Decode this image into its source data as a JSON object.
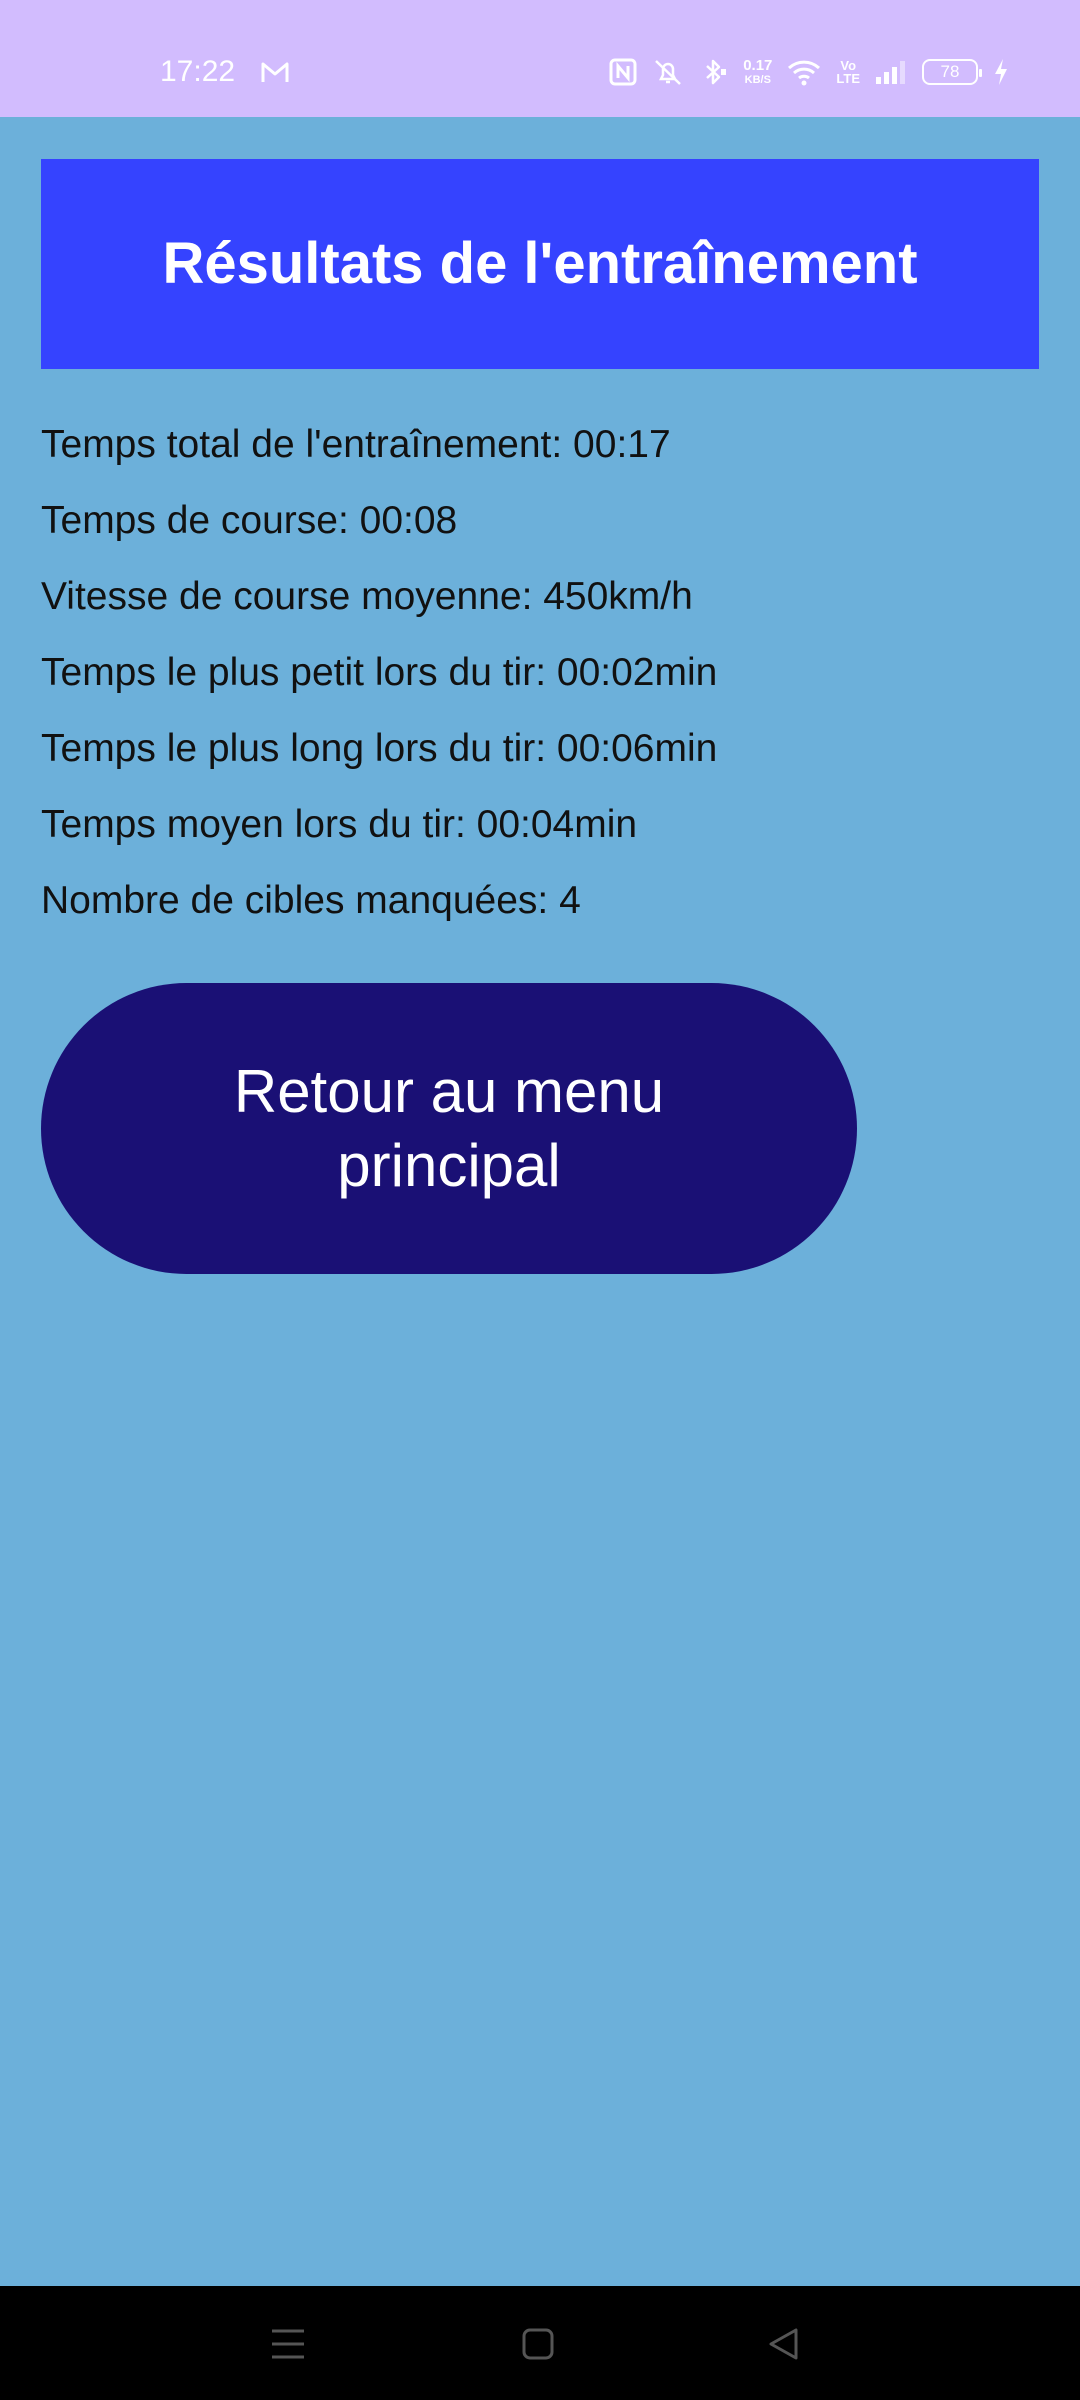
{
  "status_bar": {
    "time": "17:22",
    "net_speed_value": "0.17",
    "net_speed_unit": "KB/S",
    "volte_top": "Vo",
    "volte_bottom": "LTE",
    "battery": "78",
    "icons": [
      "gmail-icon",
      "nfc-icon",
      "mute-icon",
      "bluetooth-icon",
      "wifi-icon",
      "signal-icon",
      "charging-icon"
    ],
    "background": "#d2bcfe"
  },
  "header": {
    "title": "Résultats de l'entraînement",
    "background": "#3543ff"
  },
  "stats": {
    "total_time": "Temps total de l'entraînement: 00:17",
    "run_time": "Temps de course: 00:08",
    "avg_speed": "Vitesse de course moyenne: 450km/h",
    "min_shot_time": "Temps le plus petit lors du tir: 00:02min",
    "max_shot_time": "Temps le plus long lors du tir: 00:06min",
    "avg_shot_time": "Temps moyen lors du tir: 00:04min",
    "missed_targets": "Nombre de cibles manquées: 4"
  },
  "actions": {
    "back_label": "Retour au menu principal",
    "back_color": "#1a1075"
  },
  "nav_bar": {
    "buttons": [
      "menu-icon",
      "home-icon",
      "back-icon"
    ]
  },
  "colors": {
    "page_background": "#6cb0da",
    "text": "#111111"
  }
}
